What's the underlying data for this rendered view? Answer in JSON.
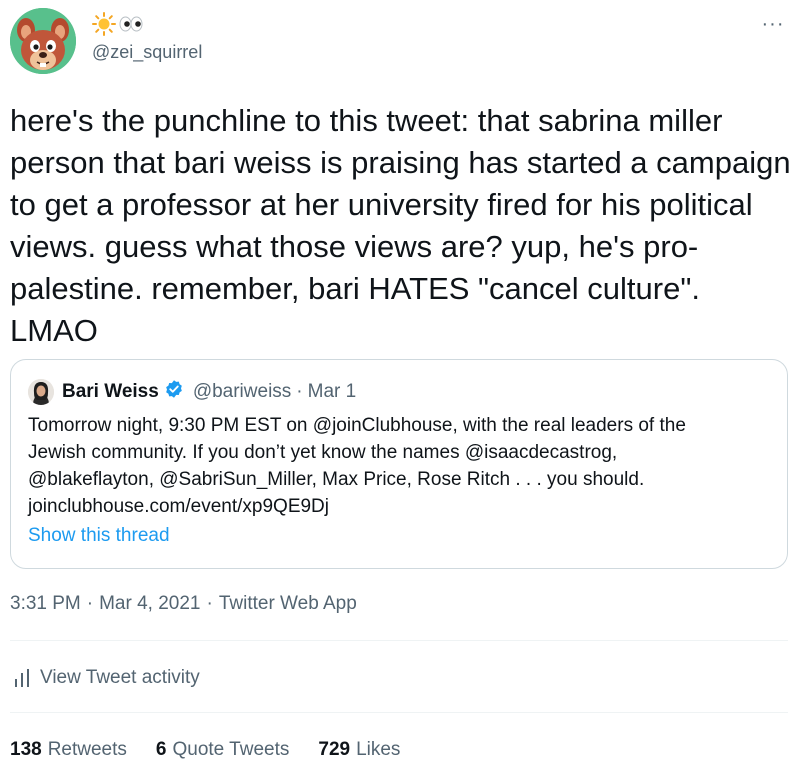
{
  "author": {
    "display_name_icons": [
      "sun-icon",
      "eyes-icon"
    ],
    "handle": "@zei_squirrel",
    "avatar_icon": "squirrel-avatar-icon"
  },
  "more_icon": "more-horizontal-icon",
  "more_label": "···",
  "tweet_text": "here's the punchline to this tweet: that sabrina miller person that bari weiss is praising has started a campaign to get a professor at her university fired for his political views. guess what those views are? yup, he's pro-palestine. remember, bari HATES \"cancel culture\". LMAO",
  "quote": {
    "name": "Bari Weiss",
    "verified_icon": "verified-badge-icon",
    "handle": "@bariweiss",
    "separator": "·",
    "date": "Mar 1",
    "text_lines": [
      "Tomorrow night, 9:30 PM EST on @joinClubhouse, with the real leaders of the",
      "Jewish community. If you don’t yet know the names @isaacdecastrog,",
      "@blakeflayton, @SabriSun_Miller, Max Price, Rose Ritch . . .  you should.",
      "joinclubhouse.com/event/xp9QE9Dj"
    ],
    "show_thread": "Show this thread"
  },
  "meta": {
    "time": "3:31 PM",
    "date": "Mar 4, 2021",
    "source": "Twitter Web App",
    "separator": "·"
  },
  "activity": {
    "icon": "bar-chart-icon",
    "label": "View Tweet activity"
  },
  "stats": {
    "retweets_count": "138",
    "retweets_label": "Retweets",
    "quotes_count": "6",
    "quotes_label": "Quote Tweets",
    "likes_count": "729",
    "likes_label": "Likes"
  },
  "colors": {
    "link": "#1d9bf0",
    "secondary_text": "#536471",
    "border": "#cfd9de",
    "divider": "#eff3f4",
    "avatar_bg": "#58c08c"
  }
}
